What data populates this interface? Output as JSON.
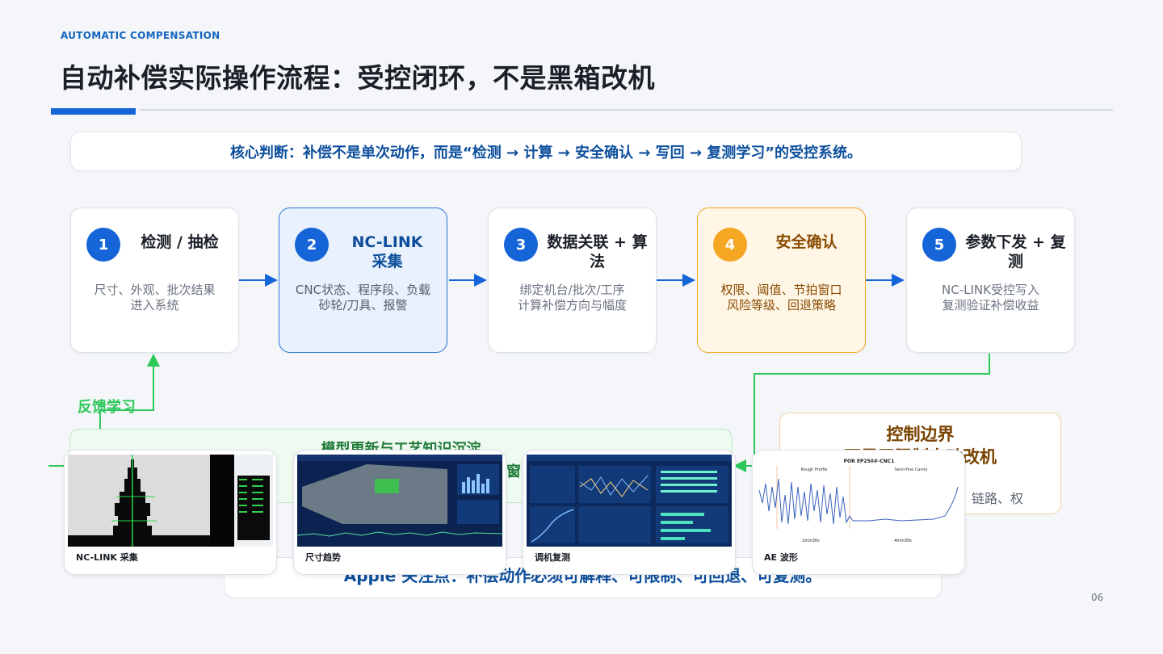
{
  "header": {
    "eyebrow": "AUTOMATIC COMPENSATION",
    "title": "自动补偿实际操作流程：受控闭环，不是黑箱改机"
  },
  "judgement": "核心判断：补偿不是单次动作，而是“检测 → 计算 → 安全确认 → 写回 → 复测学习”的受控系统。",
  "steps": [
    {
      "num": "1",
      "title": "检测 / 抽检",
      "body": "尺寸、外观、批次结果\n进入系统"
    },
    {
      "num": "2",
      "title": "NC-LINK 采集",
      "body": "CNC状态、程序段、负载\n砂轮/刀具、报警"
    },
    {
      "num": "3",
      "title": "数据关联 + 算法",
      "body": "绑定机台/批次/工序\n计算补偿方向与幅度"
    },
    {
      "num": "4",
      "title": "安全确认",
      "body": "权限、阈值、节拍窗口\n风险等级、回退策略"
    },
    {
      "num": "5",
      "title": "参数下发 + 复测",
      "body": "NC-LINK受控写入\n复测验证补偿收益"
    }
  ],
  "feedback": {
    "label": "反馈学习",
    "box_title": "模型更新与工艺知识沉淀",
    "box_fragment": "窗"
  },
  "boundary": {
    "title": "控制边界\n不是无限制自动改机",
    "text_fragment": "链路、权"
  },
  "apple_note": "Apple 关注点：补偿动作必须可解释、可限制、可回退、可复测。",
  "thumbnails": [
    {
      "caption": "NC-LINK 采集"
    },
    {
      "caption": "尺寸趋势"
    },
    {
      "caption": "调机复测"
    },
    {
      "caption": "AE 波形",
      "chart_title": "POR EP250#-CNC1",
      "legend_left": "Rough Profile",
      "legend_right": "Semi-fine Cavity",
      "time_left": "2min30s",
      "time_right": "4min30s"
    }
  ],
  "page_number": "06",
  "colors": {
    "primary_blue": "#1565d8",
    "accent_orange": "#f5a623",
    "feedback_green": "#2ec85a",
    "text_dark": "#1b1f27"
  }
}
